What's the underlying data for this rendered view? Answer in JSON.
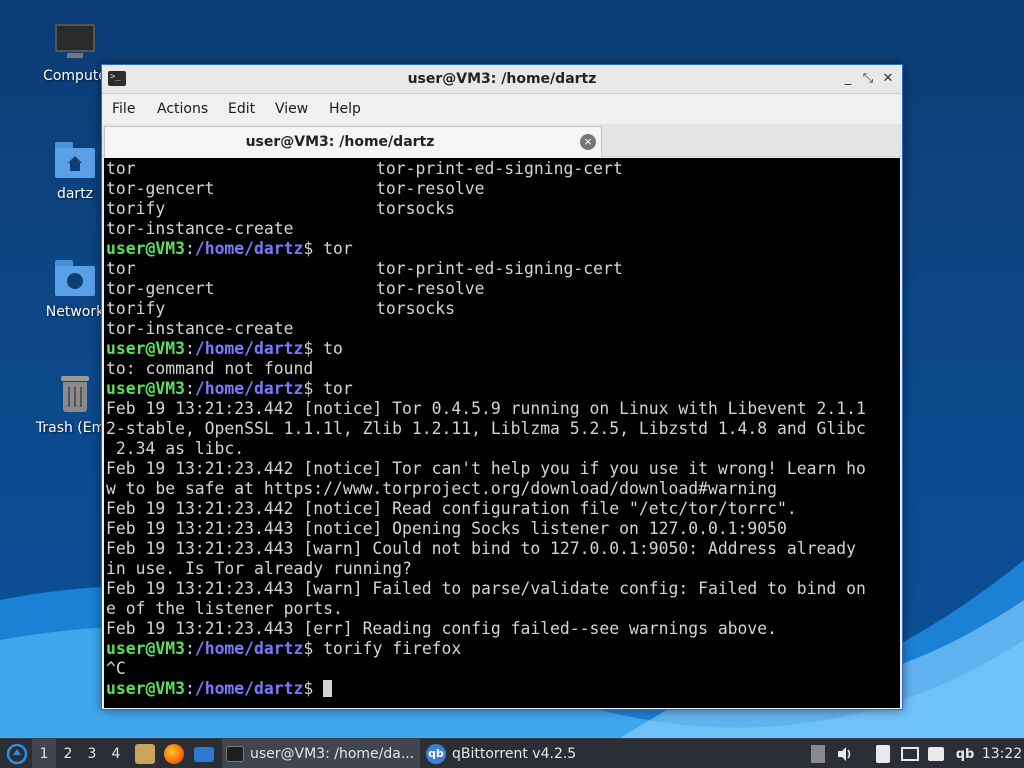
{
  "desktop": {
    "icons": [
      {
        "label": "Compute",
        "icon": "computer-icon"
      },
      {
        "label": "dartz",
        "icon": "home-folder-icon"
      },
      {
        "label": "Network",
        "icon": "network-folder-icon"
      },
      {
        "label": "Trash (Emp",
        "icon": "trash-icon"
      }
    ]
  },
  "window": {
    "title": "user@VM3: /home/dartz",
    "controls": {
      "minimize": "_",
      "maximize": "⤡",
      "close": "✕"
    },
    "menu": [
      "File",
      "Actions",
      "Edit",
      "View",
      "Help"
    ],
    "tab": {
      "label": "user@VM3: /home/dartz",
      "close": "×"
    }
  },
  "prompt": {
    "user": "user@VM3",
    "sep": ":",
    "path": "/home/dartz",
    "sigil": "$"
  },
  "terminal": {
    "lines": [
      {
        "a": "tor",
        "b": "tor-print-ed-signing-cert"
      },
      {
        "a": "tor-gencert",
        "b": "tor-resolve"
      },
      {
        "a": "torify",
        "b": "torsocks"
      },
      {
        "a": "tor-instance-create"
      },
      {
        "cmd": " tor"
      },
      {
        "a": "tor",
        "b": "tor-print-ed-signing-cert"
      },
      {
        "a": "tor-gencert",
        "b": "tor-resolve"
      },
      {
        "a": "torify",
        "b": "torsocks"
      },
      {
        "a": "tor-instance-create"
      },
      {
        "cmd": " to"
      },
      {
        "a": "to: command not found"
      },
      {
        "cmd": " tor"
      },
      {
        "a": "Feb 19 13:21:23.442 [notice] Tor 0.4.5.9 running on Linux with Libevent 2.1.1"
      },
      {
        "a": "2-stable, OpenSSL 1.1.1l, Zlib 1.2.11, Liblzma 5.2.5, Libzstd 1.4.8 and Glibc"
      },
      {
        "a": " 2.34 as libc."
      },
      {
        "a": "Feb 19 13:21:23.442 [notice] Tor can't help you if you use it wrong! Learn ho"
      },
      {
        "a": "w to be safe at https://www.torproject.org/download/download#warning"
      },
      {
        "a": "Feb 19 13:21:23.442 [notice] Read configuration file \"/etc/tor/torrc\"."
      },
      {
        "a": "Feb 19 13:21:23.443 [notice] Opening Socks listener on 127.0.0.1:9050"
      },
      {
        "a": "Feb 19 13:21:23.443 [warn] Could not bind to 127.0.0.1:9050: Address already"
      },
      {
        "a": "in use. Is Tor already running?"
      },
      {
        "a": "Feb 19 13:21:23.443 [warn] Failed to parse/validate config: Failed to bind on"
      },
      {
        "a": "e of the listener ports."
      },
      {
        "a": "Feb 19 13:21:23.443 [err] Reading config failed--see warnings above."
      },
      {
        "cmd": " torify firefox"
      },
      {
        "a": "^C"
      },
      {
        "cmd": " ",
        "cursor": true
      }
    ]
  },
  "taskbar": {
    "workspaces": [
      "1",
      "2",
      "3",
      "4"
    ],
    "tasks": [
      {
        "label": "user@VM3: /home/da...",
        "icon": "terminal-icon"
      },
      {
        "label": "qBittorrent v4.2.5",
        "icon": "qbittorrent-icon"
      }
    ],
    "tray_text": "qb",
    "clock": "13:22",
    "colors": {
      "taskbar": "#2b2f35",
      "prompt_user": "#5ce05c",
      "prompt_path": "#7a7aff"
    }
  }
}
